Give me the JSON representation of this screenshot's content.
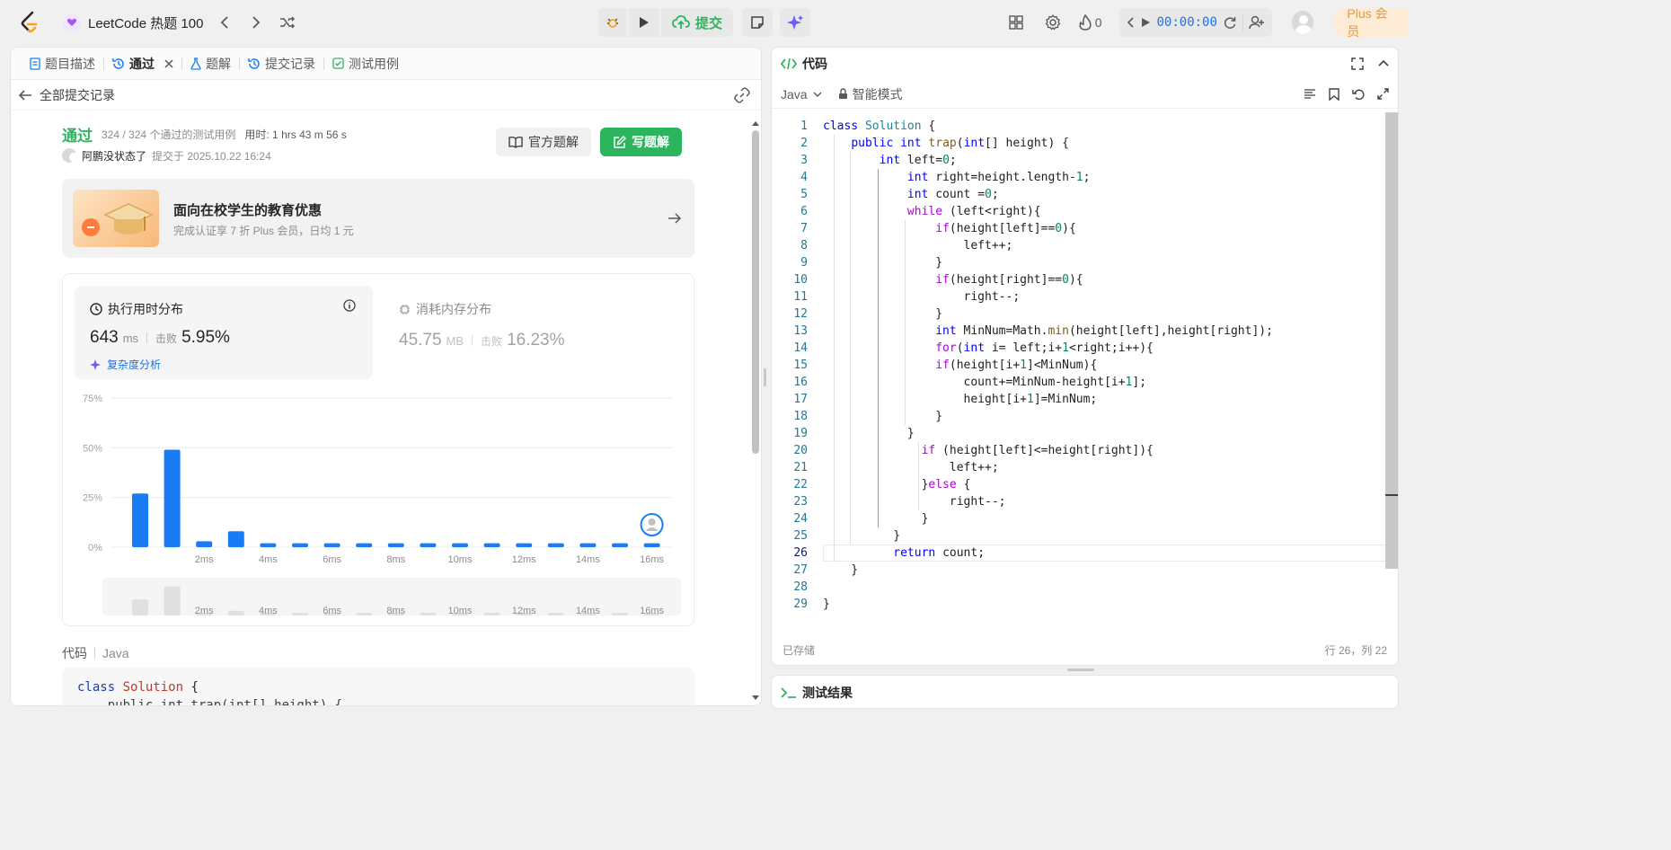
{
  "topnav": {
    "list_title": "LeetCode 热题 100",
    "submit_label": "提交",
    "streak_count": "0",
    "timer": "00:00:00",
    "plus_label": "Plus 会员"
  },
  "left": {
    "tabs": [
      {
        "label": "题目描述"
      },
      {
        "label": "通过"
      },
      {
        "label": "题解"
      },
      {
        "label": "提交记录"
      },
      {
        "label": "测试用例"
      }
    ],
    "back_label": "全部提交记录",
    "status": "通过",
    "testcases": "324 / 324 个通过的测试用例",
    "duration": "用时: 1 hrs 43 m 56 s",
    "author": "阿鹏没状态了",
    "submitted_at": "提交于 2025.10.22 16:24",
    "btn_official": "官方题解",
    "btn_write": "写题解",
    "promo_title": "面向在校学生的教育优惠",
    "promo_sub": "完成认证享 7 折 Plus 会员，日均 1 元",
    "runtime_title": "执行用时分布",
    "runtime_value": "643",
    "runtime_unit": "ms",
    "beats_label": "击败",
    "runtime_beats": "5.95%",
    "complexity_label": "复杂度分析",
    "memory_title": "消耗内存分布",
    "memory_value": "45.75",
    "memory_unit": "MB",
    "memory_beats": "16.23%",
    "code_label": "代码",
    "code_lang": "Java",
    "preview_line1": "class Solution {",
    "preview_line2": "    public int trap(int[] height) {"
  },
  "chart_data": {
    "type": "bar",
    "categories": [
      "0ms",
      "1ms",
      "2ms",
      "3ms",
      "4ms",
      "5ms",
      "6ms",
      "7ms",
      "8ms",
      "9ms",
      "10ms",
      "11ms",
      "12ms",
      "13ms",
      "14ms",
      "15ms",
      "16ms"
    ],
    "values": [
      27,
      49,
      3,
      8,
      2,
      2,
      2,
      2,
      2,
      2,
      2,
      2,
      2,
      2,
      2,
      2,
      2
    ],
    "y_ticks": [
      "0%",
      "25%",
      "50%",
      "75%"
    ],
    "x_tick_labels": [
      "2ms",
      "4ms",
      "6ms",
      "8ms",
      "10ms",
      "12ms",
      "14ms",
      "16ms"
    ],
    "ylim": [
      0,
      75
    ],
    "grid": true,
    "bar_color": "#1a7cf5"
  },
  "right": {
    "title": "代码",
    "lang": "Java",
    "mode": "智能模式",
    "saved": "已存储",
    "cursor": "行 26，列 22"
  },
  "code_lines": [
    "class Solution {",
    "    public int trap(int[] height) {",
    "        int left=0;",
    "            int right=height.length-1;",
    "            int count =0;",
    "            while (left<right){",
    "                if(height[left]==0){",
    "                    left++;",
    "                }",
    "                if(height[right]==0){",
    "                    right--;",
    "                }",
    "                int MinNum=Math.min(height[left],height[right]);",
    "                for(int i= left;i+1<right;i++){",
    "                if(height[i+1]<MinNum){",
    "                    count+=MinNum-height[i+1];",
    "                    height[i+1]=MinNum;",
    "                }",
    "            }",
    "              if (height[left]<=height[right]){",
    "                  left++;",
    "              }else {",
    "                  right--;",
    "              }",
    "          }",
    "          return count;",
    "    }",
    "",
    "}"
  ],
  "bottom": {
    "title": "测试结果"
  }
}
